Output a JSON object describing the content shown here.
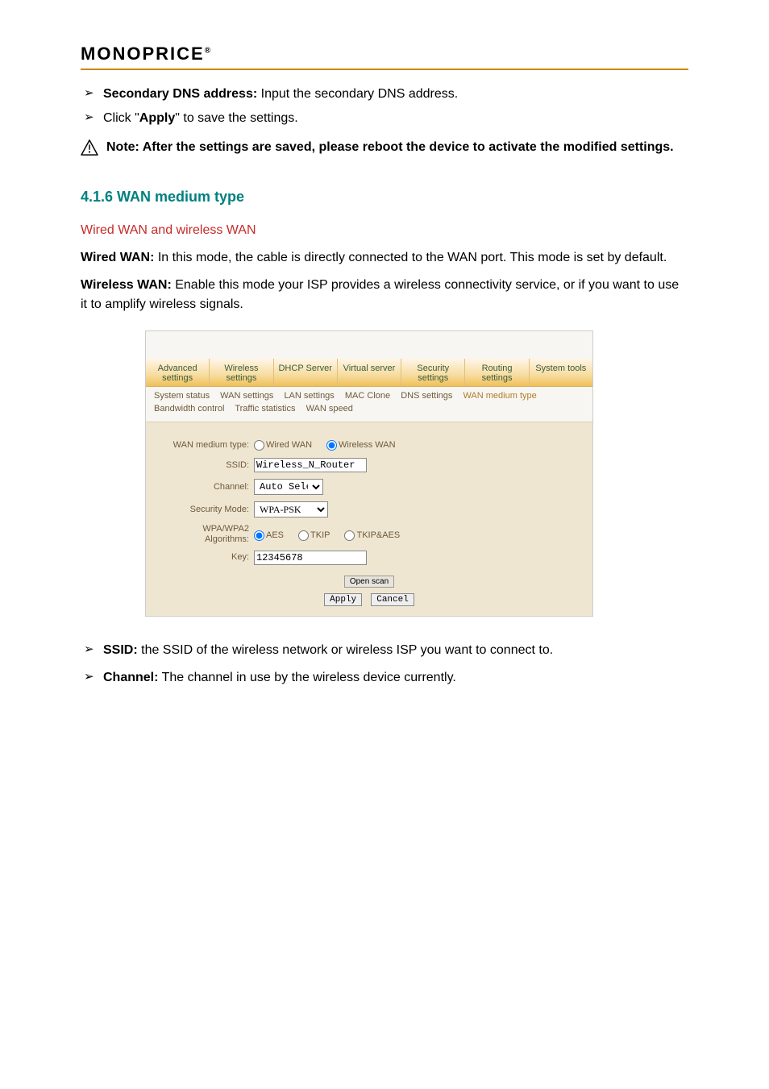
{
  "brand": "MONOPRICE",
  "brand_sup": "®",
  "bullets_top": [
    "Secondary DNS address: Input the secondary DNS address.",
    "Click \"Apply\" to save the settings."
  ],
  "note_label": "Note:",
  "note_text": "After the settings are saved, please reboot the device to activate the modified settings.",
  "section_title": "4.1.6 WAN medium type",
  "para_link": "Wired WAN and wireless WAN",
  "para2_a": "Wired WAN:",
  "para2_b": " In this mode, the cable is directly connected to the WAN port. This mode is set by default.",
  "para3_a": "Wireless WAN:",
  "para3_b": " Enable this mode your ISP provides a wireless connectivity service, or if you want to use it to amplify wireless signals.",
  "shot": {
    "tabs": [
      "Advanced settings",
      "Wireless settings",
      "DHCP Server",
      "Virtual server",
      "Security settings",
      "Routing settings",
      "System tools"
    ],
    "subnav": [
      "System status",
      "WAN settings",
      "LAN settings",
      "MAC Clone",
      "DNS settings",
      "WAN medium type",
      "Bandwidth control",
      "Traffic statistics",
      "WAN speed"
    ],
    "subnav_active": "WAN medium type",
    "fields": {
      "medium_label": "WAN medium type:",
      "medium_options": [
        "Wired WAN",
        "Wireless WAN"
      ],
      "medium_selected": "Wireless WAN",
      "ssid_label": "SSID:",
      "ssid_value": "Wireless_N_Router",
      "channel_label": "Channel:",
      "channel_value": "Auto Select",
      "sec_label": "Security Mode:",
      "sec_value": "WPA-PSK",
      "algo_label": "WPA/WPA2 Algorithms:",
      "algo_options": [
        "AES",
        "TKIP",
        "TKIP&AES"
      ],
      "algo_selected": "AES",
      "key_label": "Key:",
      "key_value": "12345678",
      "open_scan": "Open scan",
      "apply": "Apply",
      "cancel": "Cancel"
    }
  },
  "bullets_below": [
    {
      "term": "SSID:",
      "body": " the SSID of the wireless network or wireless ISP you want to connect to."
    },
    {
      "term": "Channel:",
      "body": " The channel in use by the wireless device currently."
    }
  ]
}
